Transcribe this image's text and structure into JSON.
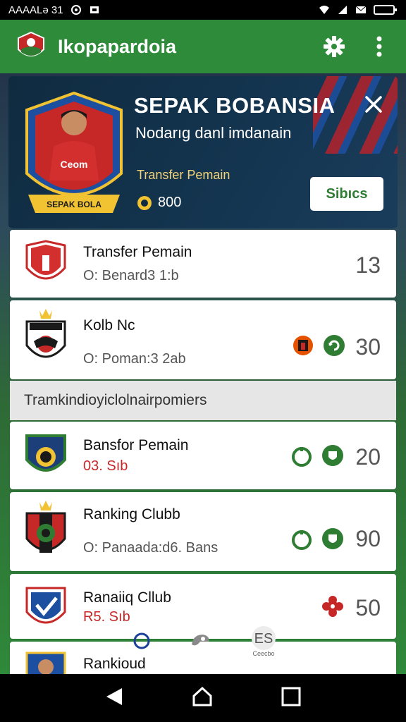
{
  "status": {
    "carrier": "AAAALə 31",
    "icons": [
      "circle-o-icon",
      "sim-icon",
      "wifi-icon",
      "signal-icon",
      "mail-icon",
      "battery-icon"
    ]
  },
  "app": {
    "title": "Ikopapardoia",
    "actions": [
      "gear-icon",
      "more-vert-icon"
    ],
    "brand_color": "#2e8b3a"
  },
  "hero": {
    "title": "SEPAK BOBANSIA",
    "subtitle": "Nodarıg danl imdanain",
    "transfer_label": "Transfer Pemain",
    "coins": "800",
    "button": "Sibıcs",
    "badge_name": "Ceom",
    "badge_banner": "SEPAK BOLA"
  },
  "rows": [
    {
      "title": "Transfer Pemain",
      "sub": "O: Benard3 1:b",
      "value": "13",
      "icons": []
    },
    {
      "title": "Kolb Nc",
      "sub": "O: Poman:3 2ab",
      "value": "30",
      "icons": [
        "club-badge-icon",
        "green-refresh-icon"
      ]
    }
  ],
  "section": {
    "label": "Tramkindioyiclolnairpomiers"
  },
  "rows2": [
    {
      "title": "Bansfor Pemain",
      "sub": "03. Sıb",
      "value": "20",
      "icons": [
        "apple-icon",
        "shield-icon"
      ]
    },
    {
      "title": "Ranking Clubb",
      "sub": "O: Panaada:d6. Bans",
      "value": "90",
      "icons": [
        "apple-icon",
        "shield-icon"
      ]
    },
    {
      "title": "Ranaiiq Cllub",
      "sub": "R5. Sıb",
      "value": "50",
      "icons": [
        "red-flower-icon"
      ]
    },
    {
      "title": "Rankioud",
      "sub": "",
      "value": "",
      "icons": []
    }
  ],
  "bottom_tabs": {
    "third_label": "Ceecbo"
  },
  "nav": [
    "back-icon",
    "home-icon",
    "recents-icon"
  ]
}
